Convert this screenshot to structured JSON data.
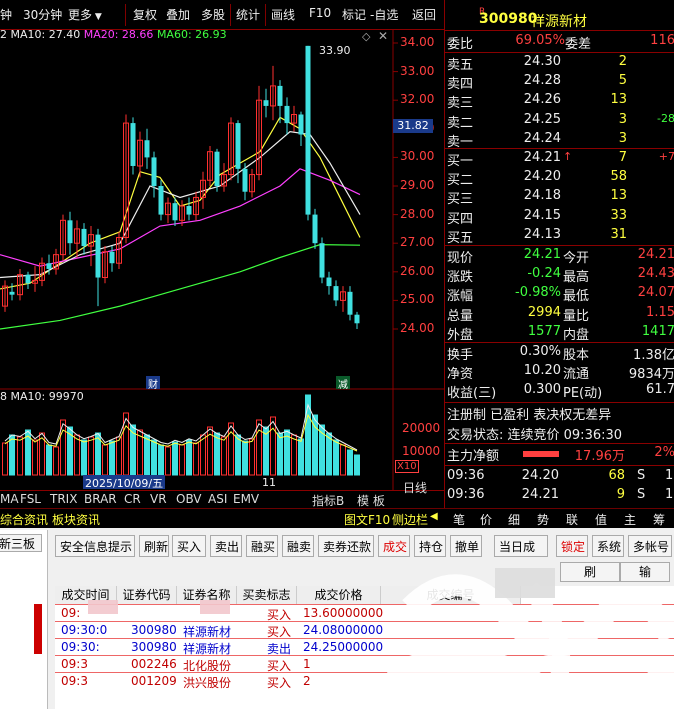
{
  "toolbar": {
    "items": [
      "钟",
      "30分钟",
      "更多",
      "复权",
      "叠加",
      "多股",
      "统计",
      "画线",
      "F10",
      "标记",
      "-自选",
      "返回"
    ]
  },
  "ma_legend": {
    "prefix": "2",
    "ma10": "MA10: 27.40",
    "ma20": "MA20: 28.66",
    "ma60": "MA60: 26.93"
  },
  "price_axis": [
    "34.00",
    "33.00",
    "32.00",
    "31.00",
    "30.00",
    "29.00",
    "28.00",
    "27.00",
    "26.00",
    "25.00",
    "24.00"
  ],
  "current_price_tag": "31.82",
  "high_label": "33.90",
  "markers": {
    "cai": "财",
    "jian": "减"
  },
  "date_tag": "2025/10/09/五",
  "date_tag2": "11",
  "vol_legend": {
    "prefix": "8",
    "ma10": "MA10: 99970"
  },
  "vol_axis": [
    "20000",
    "10000"
  ],
  "vol_unit": "X10",
  "indicators": [
    "MA",
    "FSL",
    "TRIX",
    "BRAR",
    "CR",
    "VR",
    "OBV",
    "ASI",
    "EMV"
  ],
  "ind_right": {
    "sel": "指标B",
    "tpl": "模 板",
    "day": "日线"
  },
  "tabs_left": [
    "综合资讯",
    "板块资讯"
  ],
  "tabs_right": {
    "f10": "图文F10",
    "side": "侧边栏",
    "items": [
      "笔",
      "价",
      "细",
      "势",
      "联",
      "值",
      "主",
      "筹"
    ]
  },
  "stock": {
    "marker": "R",
    "code": "300980",
    "name": "祥源新材"
  },
  "weibi": {
    "label": "委比",
    "value": "69.05%",
    "label2": "委差",
    "value2": "116"
  },
  "asks": [
    {
      "label": "卖五",
      "price": "24.30",
      "vol": "2",
      "chg": ""
    },
    {
      "label": "卖四",
      "price": "24.28",
      "vol": "5",
      "chg": ""
    },
    {
      "label": "卖三",
      "price": "24.26",
      "vol": "13",
      "chg": ""
    },
    {
      "label": "卖二",
      "price": "24.25",
      "vol": "3",
      "chg": "-28"
    },
    {
      "label": "卖一",
      "price": "24.24",
      "vol": "3",
      "chg": ""
    }
  ],
  "bids": [
    {
      "label": "买一",
      "price": "24.21",
      "vol": "7",
      "chg": "+7",
      "arrow": "↑"
    },
    {
      "label": "买二",
      "price": "24.20",
      "vol": "58",
      "chg": ""
    },
    {
      "label": "买三",
      "price": "24.18",
      "vol": "13",
      "chg": ""
    },
    {
      "label": "买四",
      "price": "24.15",
      "vol": "33",
      "chg": ""
    },
    {
      "label": "买五",
      "price": "24.13",
      "vol": "31",
      "chg": ""
    }
  ],
  "quote": [
    {
      "l1": "现价",
      "v1": "24.21",
      "l2": "今开",
      "v2": "24.21"
    },
    {
      "l1": "涨跌",
      "v1": "-0.24",
      "l2": "最高",
      "v2": "24.43"
    },
    {
      "l1": "涨幅",
      "v1": "-0.98%",
      "l2": "最低",
      "v2": "24.07"
    },
    {
      "l1": "总量",
      "v1": "2994",
      "l2": "量比",
      "v2": "1.15"
    },
    {
      "l1": "外盘",
      "v1": "1577",
      "l2": "内盘",
      "v2": "1417"
    }
  ],
  "quote2": [
    {
      "l1": "换手",
      "v1": "0.30%",
      "l2": "股本",
      "v2": "1.38亿"
    },
    {
      "l1": "净资",
      "v1": "10.20",
      "l2": "流通",
      "v2": "9834万"
    },
    {
      "l1": "收益(三)",
      "v1": "0.300",
      "l2": "PE(动)",
      "v2": "61.7"
    }
  ],
  "info_line": "注册制 已盈利 表决权无差异",
  "trade_status": "交易状态: 连续竞价 09:36:30",
  "main_net": {
    "label": "主力净额",
    "value": "17.96万",
    "pct": "2%"
  },
  "ticks": [
    {
      "time": "09:36",
      "price": "24.20",
      "vol": "68",
      "flag": "S",
      "extra": "1"
    },
    {
      "time": "09:36",
      "price": "24.21",
      "vol": "9",
      "flag": "S",
      "extra": "1"
    }
  ],
  "lower": {
    "left_tab": "新三板",
    "buttons": [
      "安全信息提示",
      "刷新",
      "买入",
      "卖出",
      "融买",
      "融卖",
      "卖券还款",
      "成交",
      "持仓",
      "撤单",
      "当日成",
      "锁定",
      "系统",
      "多帐号"
    ],
    "sub_buttons": [
      "刷",
      "输"
    ],
    "col_extra": "额",
    "headers": [
      "成交时间",
      "证券代码",
      "证券名称",
      "买卖标志",
      "成交价格",
      "成交编号"
    ],
    "rows": [
      {
        "time": "09:",
        "code": "",
        "name": "",
        "flag": "买入",
        "price": "13.60000000",
        "no": ""
      },
      {
        "time": "09:30:0",
        "code": "300980",
        "name": "祥源新材",
        "flag": "买入",
        "price": "24.08000000",
        "no": ""
      },
      {
        "time": "09:30:",
        "code": "300980",
        "name": "祥源新材",
        "flag": "卖出",
        "price": "24.25000000",
        "no": ""
      },
      {
        "time": "09:3",
        "code": "002246",
        "name": "北化股份",
        "flag": "买入",
        "price": "1",
        "no": ""
      },
      {
        "time": "09:3",
        "code": "001209",
        "name": "洪兴股份",
        "flag": "买入",
        "price": "2",
        "no": ""
      }
    ]
  }
}
